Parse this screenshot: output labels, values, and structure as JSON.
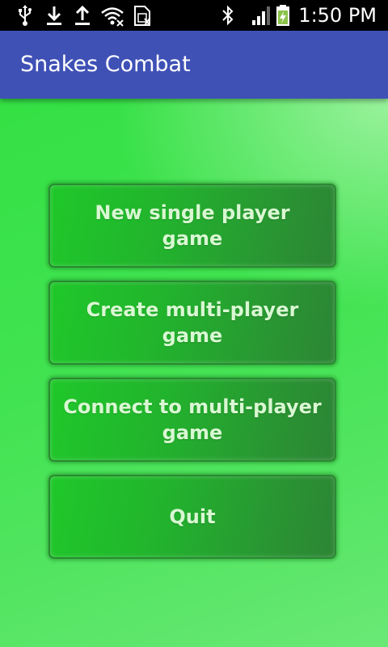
{
  "status_bar": {
    "time": "1:50 PM",
    "left_icons": [
      "usb-icon",
      "download-icon",
      "upload-icon",
      "wifi-icon",
      "sim-icon"
    ],
    "right_icons": [
      "bluetooth-icon",
      "signal-icon",
      "battery-charging-icon"
    ]
  },
  "app_bar": {
    "title": "Snakes Combat",
    "color": "#3f51b5"
  },
  "menu": {
    "new_single": "New single player game",
    "create_multi": "Create multi-player game",
    "connect_multi": "Connect to multi-player game",
    "quit": "Quit"
  },
  "colors": {
    "background": "#42e352",
    "button": "#22b32d",
    "button_text": "#d9f7d2"
  }
}
